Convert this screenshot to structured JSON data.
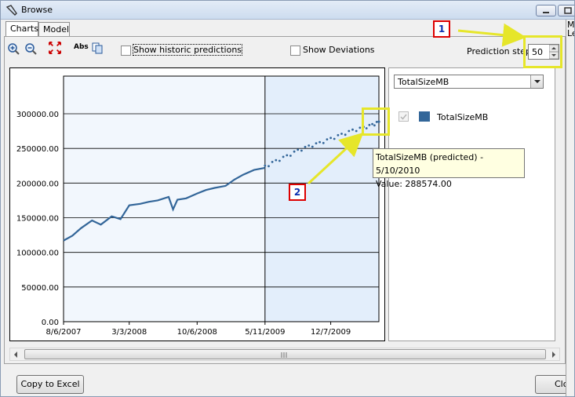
{
  "window": {
    "title": "Browse"
  },
  "tabs": [
    {
      "label": "Charts"
    },
    {
      "label": "Model"
    }
  ],
  "toolbar": {
    "abs_label": "Abs",
    "show_historic_label": "Show historic predictions",
    "show_deviations_label": "Show Deviations",
    "prediction_step_label": "Prediction step :",
    "prediction_step_value": "50"
  },
  "series_panel": {
    "combo_value": "TotalSizeMB",
    "legend_label": "TotalSizeMB",
    "legend_color": "#336699"
  },
  "tooltip": {
    "line1": "TotalSizeMB (predicted) - 5/10/2010",
    "line2": "Value: 288574.00"
  },
  "buttons": {
    "copy_excel": "Copy to Excel",
    "close": "Close"
  },
  "callouts": {
    "one": "1",
    "two": "2"
  },
  "right_strip": {
    "line1": "Mi",
    "line2": "Le"
  },
  "chart_data": {
    "type": "line",
    "title": "",
    "xlabel": "",
    "ylabel": "",
    "ylim": [
      0,
      300000
    ],
    "yticks": [
      "0.00",
      "50000.00",
      "100000.00",
      "150000.00",
      "200000.00",
      "250000.00",
      "300000.00"
    ],
    "xticks": [
      "8/6/2007",
      "3/3/2008",
      "10/6/2008",
      "5/11/2009",
      "12/7/2009"
    ],
    "forecast_start": "5/11/2009",
    "series": [
      {
        "name": "TotalSizeMB",
        "style": "solid",
        "x": [
          "8/6/2007",
          "9/3/2007",
          "10/1/2007",
          "11/5/2007",
          "12/3/2007",
          "1/7/2008",
          "2/4/2008",
          "3/3/2008",
          "4/7/2008",
          "5/5/2008",
          "6/2/2008",
          "7/7/2008",
          "7/21/2008",
          "8/4/2008",
          "9/1/2008",
          "10/6/2008",
          "11/3/2008",
          "12/1/2008",
          "1/5/2009",
          "2/2/2009",
          "3/2/2009",
          "4/6/2009",
          "5/11/2009"
        ],
        "values": [
          117000,
          124000,
          135000,
          146000,
          140000,
          152000,
          148000,
          168000,
          170000,
          173000,
          175000,
          180000,
          162000,
          176000,
          178000,
          185000,
          190000,
          193000,
          196000,
          205000,
          212000,
          219000,
          222000
        ]
      },
      {
        "name": "TotalSizeMB (predicted)",
        "style": "dotted",
        "x": [
          "5/11/2009",
          "6/15/2009",
          "7/20/2009",
          "8/24/2009",
          "9/28/2009",
          "11/2/2009",
          "12/7/2009",
          "1/11/2010",
          "2/15/2010",
          "3/22/2010",
          "4/19/2010",
          "5/10/2010"
        ],
        "values": [
          224000,
          232000,
          239000,
          247000,
          253000,
          258000,
          264000,
          270000,
          276000,
          280000,
          284000,
          288574
        ]
      }
    ]
  }
}
